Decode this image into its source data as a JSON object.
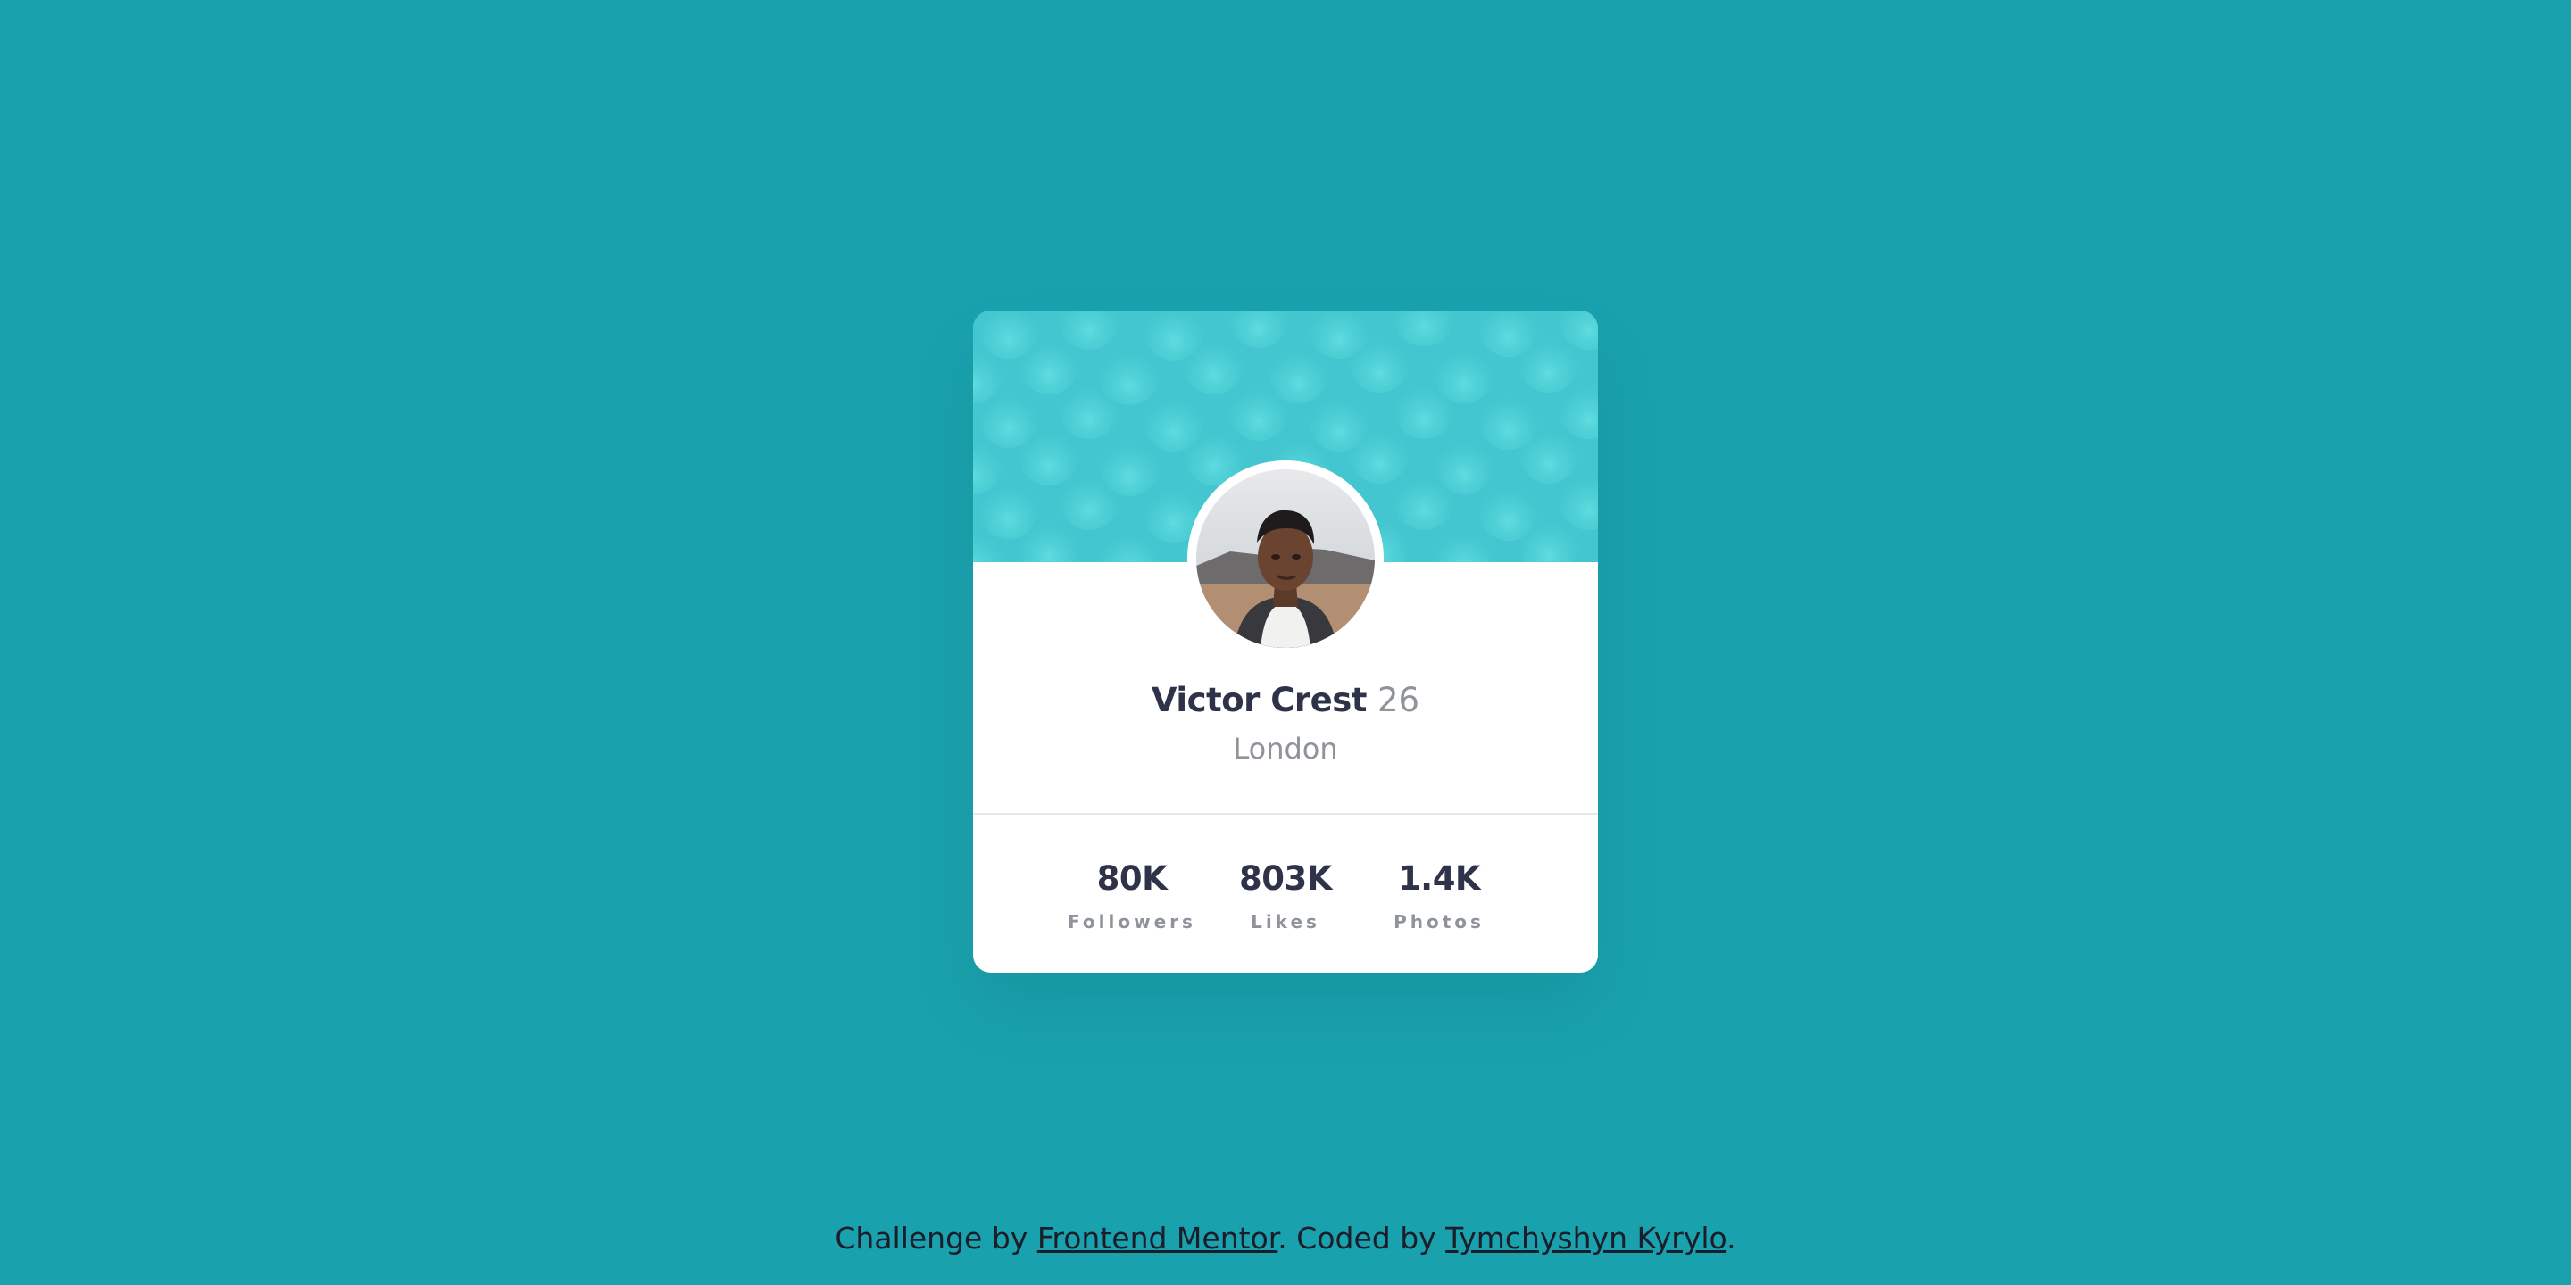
{
  "profile": {
    "name": "Victor Crest",
    "age": "26",
    "city": "London",
    "avatar_icon": "profile-photo"
  },
  "stats": [
    {
      "value": "80K",
      "label": "Followers"
    },
    {
      "value": "803K",
      "label": "Likes"
    },
    {
      "value": "1.4K",
      "label": "Photos"
    }
  ],
  "footer": {
    "prefix": "Challenge by ",
    "challenge_link": "Frontend Mentor",
    "middle": ". Coded by ",
    "author_link": "Tymchyshyn Kyrylo",
    "suffix": "."
  },
  "colors": {
    "background": "#19a2ae",
    "card": "#ffffff",
    "header": "#43c6cf",
    "primary_text": "#2e3349",
    "secondary_text": "#8f939a"
  }
}
